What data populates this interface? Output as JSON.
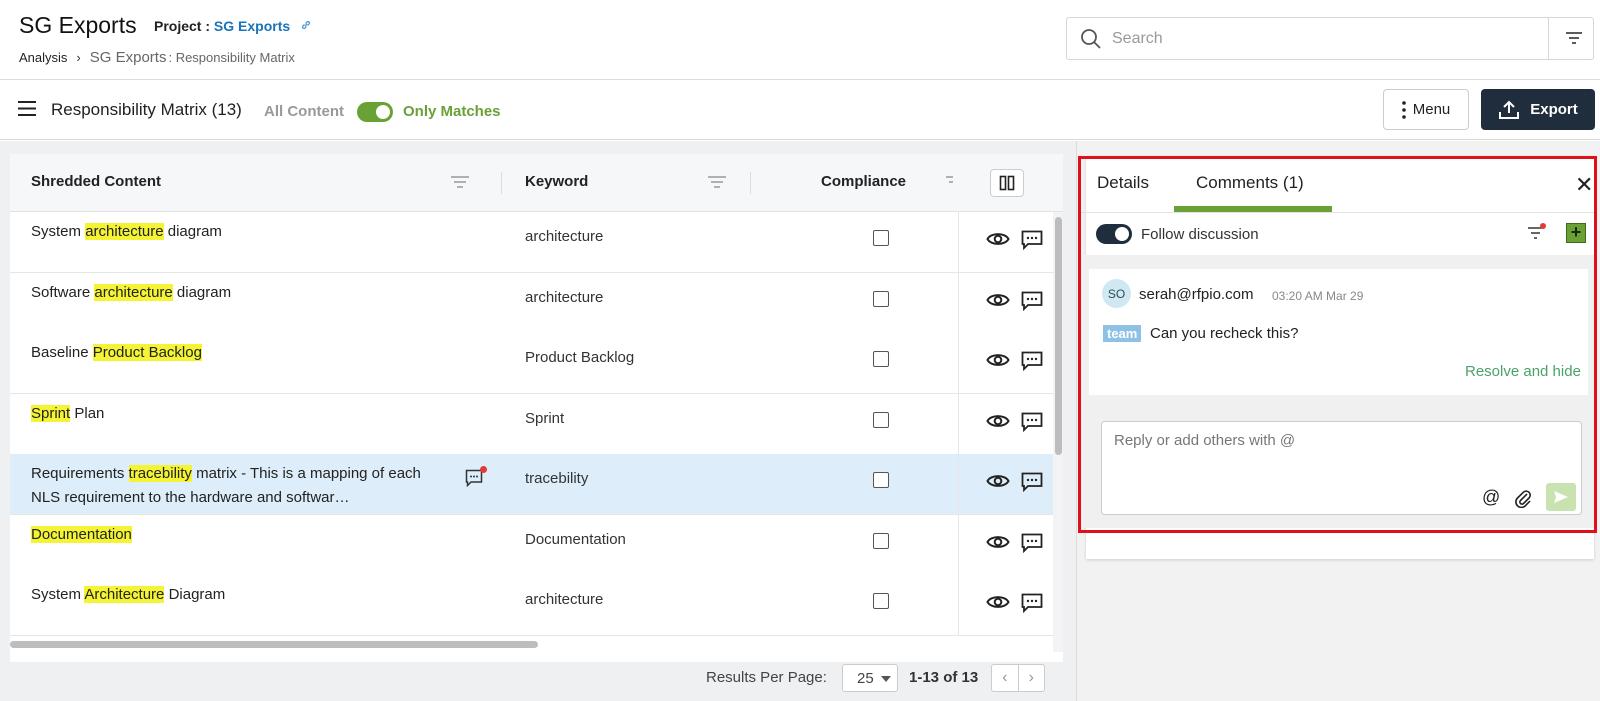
{
  "header": {
    "app_title": "SG Exports",
    "project_label": "Project :",
    "project_name": "SG Exports",
    "breadcrumb": [
      "Analysis",
      "SG Exports",
      ": Responsibility Matrix"
    ],
    "search_placeholder": "Search"
  },
  "toolbar": {
    "title": "Responsibility Matrix (13)",
    "all_content_label": "All Content",
    "only_matches_label": "Only Matches",
    "only_matches_enabled": true,
    "menu_label": "Menu",
    "export_label": "Export"
  },
  "grid": {
    "columns": [
      "Shredded Content",
      "Keyword",
      "Compliance"
    ],
    "rows": [
      {
        "content": [
          "System ",
          "architecture",
          " diagram"
        ],
        "keyword": "architecture"
      },
      {
        "content": [
          "Software ",
          "architecture",
          " diagram"
        ],
        "keyword": "architecture"
      },
      {
        "content": [
          "Baseline ",
          "Product Backlog",
          ""
        ],
        "keyword": "Product Backlog"
      },
      {
        "content": [
          "",
          "Sprint",
          " Plan"
        ],
        "keyword": "Sprint"
      },
      {
        "content": [
          "Requirements ",
          "tracebility",
          " matrix - This is a mapping of each NLS requirement to the hardware and softwar…"
        ],
        "keyword": "tracebility",
        "selected": true,
        "has_comment": true
      },
      {
        "content": [
          "",
          "Documentation",
          ""
        ],
        "keyword": "Documentation"
      },
      {
        "content": [
          "System ",
          "Architecture",
          " Diagram"
        ],
        "keyword": "architecture"
      }
    ]
  },
  "footer": {
    "results_per_page_label": "Results Per Page:",
    "results_per_page_value": "25",
    "range": "1-13 of 13"
  },
  "panel": {
    "tabs": [
      "Details",
      "Comments (1)"
    ],
    "active_tab": "Comments (1)",
    "follow_label": "Follow discussion",
    "comment": {
      "avatar": "SO",
      "author": "serah@rfpio.com",
      "time": "03:20 AM Mar 29",
      "tag": "team",
      "text": "Can you recheck this?",
      "resolve_label": "Resolve and hide"
    },
    "reply_placeholder": "Reply or add others with @"
  },
  "colors": {
    "accent_green": "#6aa136",
    "dark_navy": "#1f2d3d",
    "highlight": "#f4f434",
    "selected_row": "#ddeefa",
    "annotation_red": "#e0101a"
  }
}
